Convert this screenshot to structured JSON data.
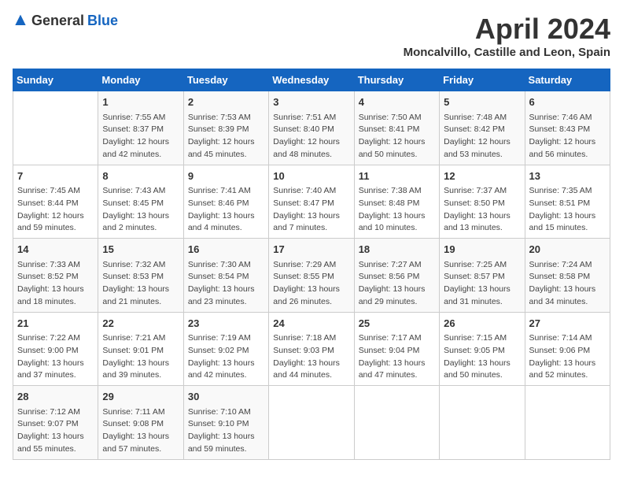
{
  "header": {
    "logo_general": "General",
    "logo_blue": "Blue",
    "month_title": "April 2024",
    "subtitle": "Moncalvillo, Castille and Leon, Spain"
  },
  "days_of_week": [
    "Sunday",
    "Monday",
    "Tuesday",
    "Wednesday",
    "Thursday",
    "Friday",
    "Saturday"
  ],
  "weeks": [
    [
      {
        "day": "",
        "info": ""
      },
      {
        "day": "1",
        "info": "Sunrise: 7:55 AM\nSunset: 8:37 PM\nDaylight: 12 hours\nand 42 minutes."
      },
      {
        "day": "2",
        "info": "Sunrise: 7:53 AM\nSunset: 8:39 PM\nDaylight: 12 hours\nand 45 minutes."
      },
      {
        "day": "3",
        "info": "Sunrise: 7:51 AM\nSunset: 8:40 PM\nDaylight: 12 hours\nand 48 minutes."
      },
      {
        "day": "4",
        "info": "Sunrise: 7:50 AM\nSunset: 8:41 PM\nDaylight: 12 hours\nand 50 minutes."
      },
      {
        "day": "5",
        "info": "Sunrise: 7:48 AM\nSunset: 8:42 PM\nDaylight: 12 hours\nand 53 minutes."
      },
      {
        "day": "6",
        "info": "Sunrise: 7:46 AM\nSunset: 8:43 PM\nDaylight: 12 hours\nand 56 minutes."
      }
    ],
    [
      {
        "day": "7",
        "info": "Sunrise: 7:45 AM\nSunset: 8:44 PM\nDaylight: 12 hours\nand 59 minutes."
      },
      {
        "day": "8",
        "info": "Sunrise: 7:43 AM\nSunset: 8:45 PM\nDaylight: 13 hours\nand 2 minutes."
      },
      {
        "day": "9",
        "info": "Sunrise: 7:41 AM\nSunset: 8:46 PM\nDaylight: 13 hours\nand 4 minutes."
      },
      {
        "day": "10",
        "info": "Sunrise: 7:40 AM\nSunset: 8:47 PM\nDaylight: 13 hours\nand 7 minutes."
      },
      {
        "day": "11",
        "info": "Sunrise: 7:38 AM\nSunset: 8:48 PM\nDaylight: 13 hours\nand 10 minutes."
      },
      {
        "day": "12",
        "info": "Sunrise: 7:37 AM\nSunset: 8:50 PM\nDaylight: 13 hours\nand 13 minutes."
      },
      {
        "day": "13",
        "info": "Sunrise: 7:35 AM\nSunset: 8:51 PM\nDaylight: 13 hours\nand 15 minutes."
      }
    ],
    [
      {
        "day": "14",
        "info": "Sunrise: 7:33 AM\nSunset: 8:52 PM\nDaylight: 13 hours\nand 18 minutes."
      },
      {
        "day": "15",
        "info": "Sunrise: 7:32 AM\nSunset: 8:53 PM\nDaylight: 13 hours\nand 21 minutes."
      },
      {
        "day": "16",
        "info": "Sunrise: 7:30 AM\nSunset: 8:54 PM\nDaylight: 13 hours\nand 23 minutes."
      },
      {
        "day": "17",
        "info": "Sunrise: 7:29 AM\nSunset: 8:55 PM\nDaylight: 13 hours\nand 26 minutes."
      },
      {
        "day": "18",
        "info": "Sunrise: 7:27 AM\nSunset: 8:56 PM\nDaylight: 13 hours\nand 29 minutes."
      },
      {
        "day": "19",
        "info": "Sunrise: 7:25 AM\nSunset: 8:57 PM\nDaylight: 13 hours\nand 31 minutes."
      },
      {
        "day": "20",
        "info": "Sunrise: 7:24 AM\nSunset: 8:58 PM\nDaylight: 13 hours\nand 34 minutes."
      }
    ],
    [
      {
        "day": "21",
        "info": "Sunrise: 7:22 AM\nSunset: 9:00 PM\nDaylight: 13 hours\nand 37 minutes."
      },
      {
        "day": "22",
        "info": "Sunrise: 7:21 AM\nSunset: 9:01 PM\nDaylight: 13 hours\nand 39 minutes."
      },
      {
        "day": "23",
        "info": "Sunrise: 7:19 AM\nSunset: 9:02 PM\nDaylight: 13 hours\nand 42 minutes."
      },
      {
        "day": "24",
        "info": "Sunrise: 7:18 AM\nSunset: 9:03 PM\nDaylight: 13 hours\nand 44 minutes."
      },
      {
        "day": "25",
        "info": "Sunrise: 7:17 AM\nSunset: 9:04 PM\nDaylight: 13 hours\nand 47 minutes."
      },
      {
        "day": "26",
        "info": "Sunrise: 7:15 AM\nSunset: 9:05 PM\nDaylight: 13 hours\nand 50 minutes."
      },
      {
        "day": "27",
        "info": "Sunrise: 7:14 AM\nSunset: 9:06 PM\nDaylight: 13 hours\nand 52 minutes."
      }
    ],
    [
      {
        "day": "28",
        "info": "Sunrise: 7:12 AM\nSunset: 9:07 PM\nDaylight: 13 hours\nand 55 minutes."
      },
      {
        "day": "29",
        "info": "Sunrise: 7:11 AM\nSunset: 9:08 PM\nDaylight: 13 hours\nand 57 minutes."
      },
      {
        "day": "30",
        "info": "Sunrise: 7:10 AM\nSunset: 9:10 PM\nDaylight: 13 hours\nand 59 minutes."
      },
      {
        "day": "",
        "info": ""
      },
      {
        "day": "",
        "info": ""
      },
      {
        "day": "",
        "info": ""
      },
      {
        "day": "",
        "info": ""
      }
    ]
  ]
}
